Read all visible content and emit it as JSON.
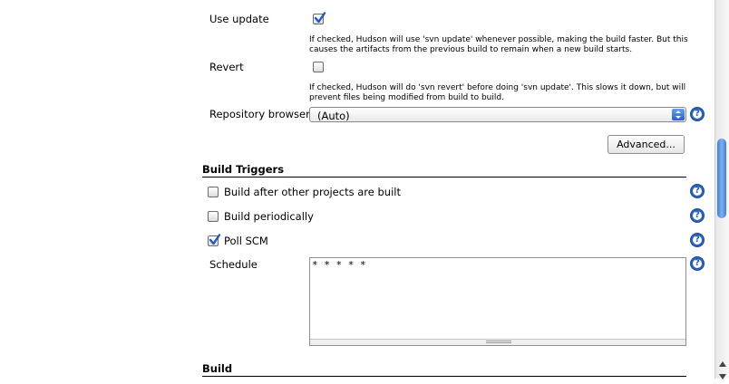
{
  "use_update": {
    "label": "Use update",
    "checked": true,
    "description_line1": "If checked, Hudson will use 'svn update' whenever possible, making the build faster. But this",
    "description_line2": "causes the artifacts from the previous build to remain when a new build starts."
  },
  "revert": {
    "label": "Revert",
    "checked": false,
    "description_line1": "If checked, Hudson will do 'svn revert' before doing 'svn update'. This slows it down, but will",
    "description_line2": "prevent files being modified from build to build."
  },
  "repository_browser": {
    "label": "Repository browser",
    "selected": "(Auto)"
  },
  "advanced_button": {
    "label": "Advanced..."
  },
  "build_triggers": {
    "title": "Build Triggers",
    "options": [
      {
        "label": "Build after other projects are built",
        "checked": false
      },
      {
        "label": "Build periodically",
        "checked": false
      },
      {
        "label": "Poll SCM",
        "checked": true
      }
    ],
    "schedule": {
      "label": "Schedule",
      "value": "* * * * *"
    }
  },
  "build": {
    "title": "Build"
  },
  "help": {
    "glyph": "?"
  },
  "colors": {
    "accent": "#2a62b8",
    "check": "#1f57c3"
  }
}
